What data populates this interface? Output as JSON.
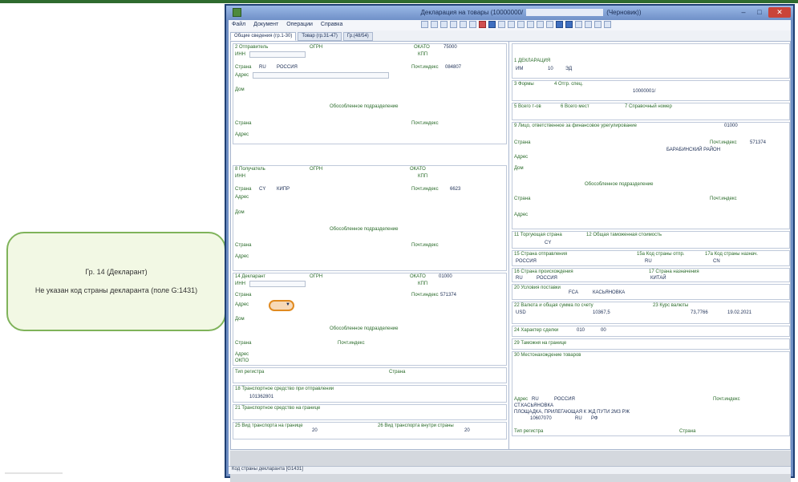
{
  "callout": {
    "line1": "Гр. 14 (Декларант)",
    "line2": "Не указан код страны декларанта (поле G:1431)"
  },
  "window": {
    "title": "Декларация на товары (10000000/",
    "title_suffix": "(Черновик))"
  },
  "menu": [
    "Файл",
    "Документ",
    "Операции",
    "Справка"
  ],
  "tabs": [
    "Общие сведения (гр.1-30)",
    "Товар (гр.31-47)",
    "Гр.(48/54)"
  ],
  "status": "Код страны декларанта [G1431]",
  "left": {
    "g2_label": "2 Отправитель",
    "g8_label": "8 Получатель",
    "g14_label": "14 Декларант",
    "country_ru": "RU",
    "country_ru_name": "РОССИЯ",
    "country_cy": "CY",
    "country_cy_name": "КИПР",
    "inn_label": "ИНН",
    "kpp_label": "КПП",
    "ogrn_label": "ОГРН",
    "okato_label": "ОКАТО",
    "okpo_label": "ОКПО",
    "postcode_label": "Почт.индекс",
    "country_label": "Страна",
    "address_label": "Адрес",
    "house_label": "Дом",
    "subdivision_label": "Обособленное подразделение",
    "fin_label": "Лицо, ответственное за фин. урегулирование",
    "g14_okato": "01000",
    "g14_postcode": "571374",
    "g2_okato": "75000",
    "g2_postcode": "084807",
    "g8_postcode": "6623",
    "g8_kpp": "КПП",
    "reg_label": "Тип регистра",
    "g18_label": "18 Транспортное средство при отправлении",
    "g18_value": "101362801",
    "g21_label": "21 Транспортное средство на границе",
    "g25_label": "25 Вид транспорта на границе",
    "g25_value": "20",
    "g26_label": "26 Вид транспорта внутри страны",
    "g26_value": "20"
  },
  "right": {
    "g1_label": "1 ДЕКЛАРАЦИЯ",
    "g1_im": "ИМ",
    "g1_code": "10",
    "g1_proc": "ЭД",
    "g3_label": "3 Формы",
    "g4_label": "4 Отгр. спец.",
    "g5_label": "5 Всего т-ов",
    "g6_label": "6 Всего мест",
    "g7_label": "7 Справочный номер",
    "g7_value": "10000001/",
    "g9_label": "9 Лицо, ответственное за финансовое урегулирование",
    "g9_okato": "01000",
    "g9_postcode": "571374",
    "g9_district": "БАРАБИНСКИЙ РАЙОН",
    "g11_label": "11 Торгующая страна",
    "g11_value": "CY",
    "g12_label": "12 Общая таможенная стоимость",
    "g15_label": "15 Страна отправления",
    "g15_value": "РОССИЯ",
    "g15a_label": "15а Код страны отпр.",
    "g15a_value": "RU",
    "g17a_label": "17а Код страны назнач.",
    "g17a_value": "CN",
    "g16_label": "16 Страна происхождения",
    "g16_code": "RU",
    "g16_name": "РОССИЯ",
    "g17_label": "17 Страна назначения",
    "g17_value": "КИТАЙ",
    "g20_label": "20 Условия поставки",
    "g20_code": "FCA",
    "g20_place": "КАСЬЯНОВКА",
    "g22_label": "22 Валюта и общая сумма по счету",
    "g22_currency": "USD",
    "g22_amount": "10367,5",
    "g23_label": "23 Курс валюты",
    "g23_value": "73,7766",
    "g23_date": "19.02.2021",
    "g24_label": "24 Характер сделки",
    "g24_code": "010",
    "g24_code2": "00",
    "g29_label": "29 Таможня на границе",
    "g30_label": "30 Местонахождение товаров",
    "g30_place": "СТ.КАСЬЯНОВКА",
    "g30_addr": "ПЛОЩАДКА, ПРИЛЕГАЮЩАЯ К ЖД ПУТИ 2МЗ РЖ",
    "g30_num": "10607070",
    "g30_ru": "RU",
    "g30_rf": "РФ"
  }
}
